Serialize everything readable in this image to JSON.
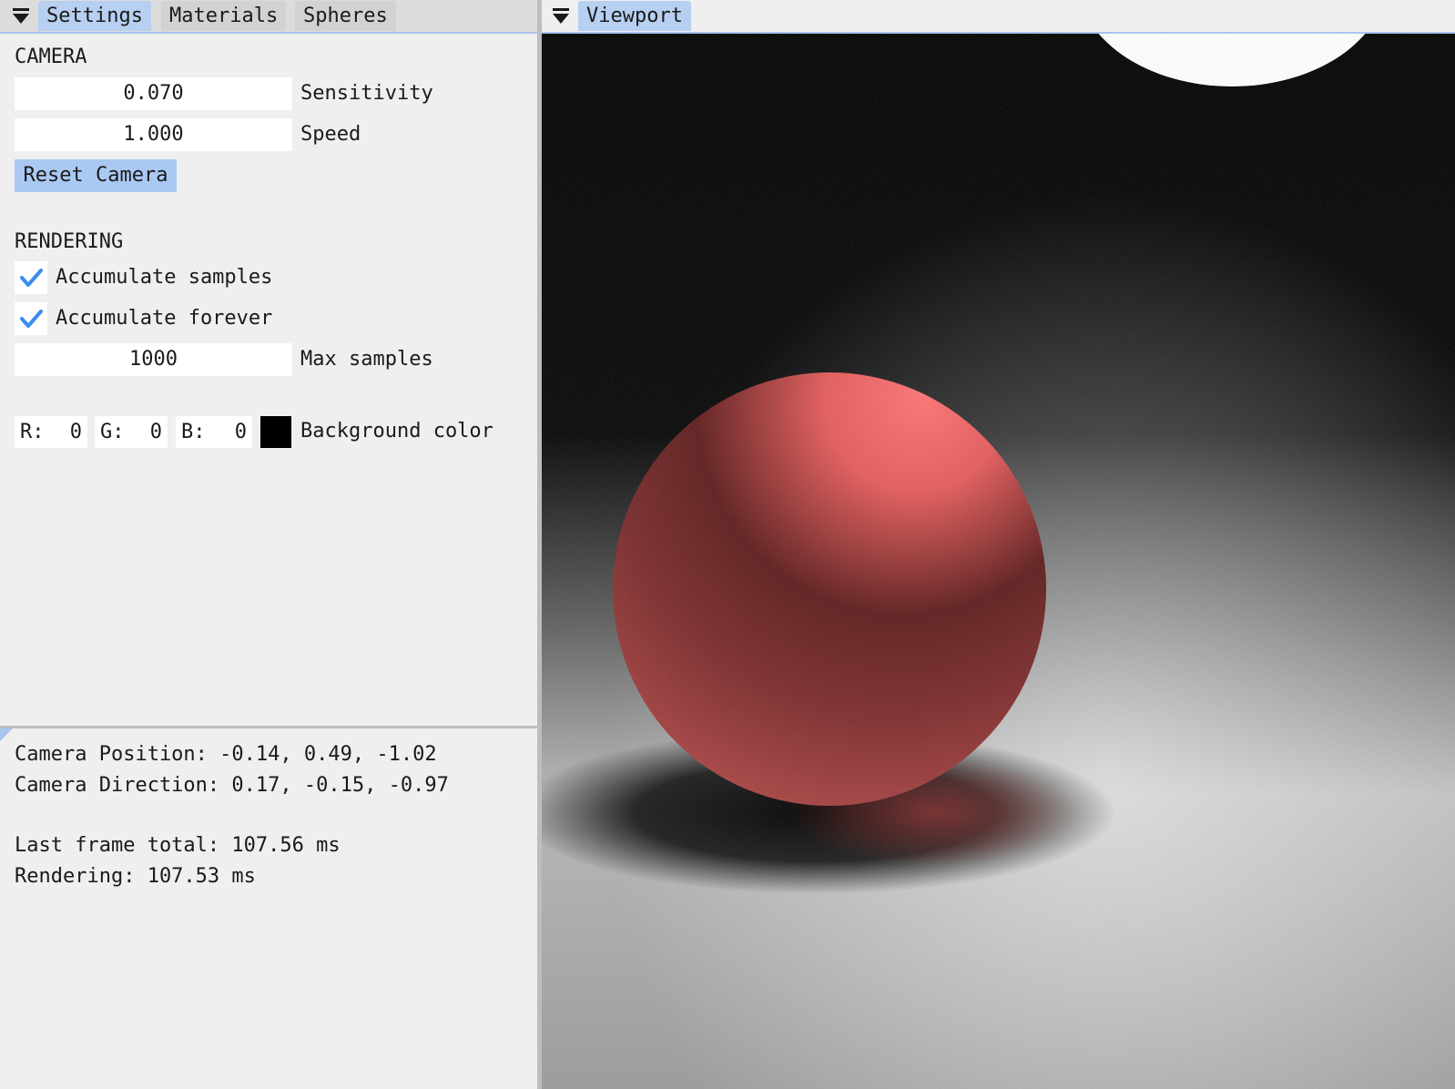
{
  "left_panel": {
    "tabs": [
      {
        "label": "Settings",
        "active": true
      },
      {
        "label": "Materials",
        "active": false
      },
      {
        "label": "Spheres",
        "active": false
      }
    ],
    "camera": {
      "heading": "CAMERA",
      "sensitivity_value": "0.070",
      "sensitivity_label": "Sensitivity",
      "speed_value": "1.000",
      "speed_label": "Speed",
      "reset_label": "Reset Camera"
    },
    "rendering": {
      "heading": "RENDERING",
      "accumulate_samples_label": "Accumulate samples",
      "accumulate_samples_checked": true,
      "accumulate_forever_label": "Accumulate forever",
      "accumulate_forever_checked": true,
      "max_samples_value": "1000",
      "max_samples_label": "Max samples"
    },
    "background": {
      "r_label": "R:",
      "r_value": "0",
      "g_label": "G:",
      "g_value": "0",
      "b_label": "B:",
      "b_value": "0",
      "swatch_color": "#000000",
      "label": "Background color"
    },
    "stats": {
      "camera_position": "Camera Position: -0.14, 0.49, -1.02",
      "camera_direction": "Camera Direction: 0.17, -0.15, -0.97",
      "last_frame_total": "Last frame total: 107.56 ms",
      "rendering": "Rendering: 107.53 ms"
    }
  },
  "right_panel": {
    "tab_label": "Viewport"
  },
  "colors": {
    "accent": "#b7cff0",
    "button": "#a9c9f3",
    "checkmark": "#3b8ded",
    "panel_bg": "#efefef",
    "sphere": "#e86a6a"
  },
  "icons": {
    "menu": "triangle-menu-icon",
    "check": "checkmark-icon"
  }
}
